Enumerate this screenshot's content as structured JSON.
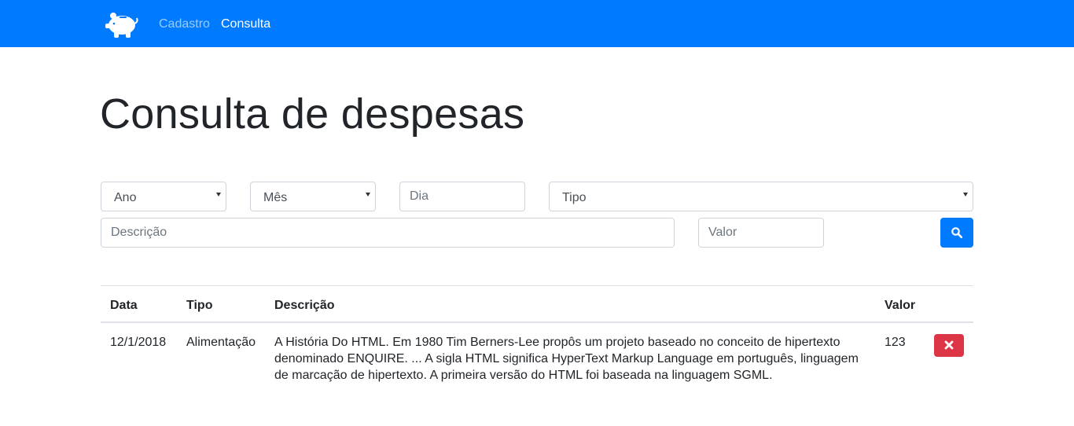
{
  "navbar": {
    "logo_icon": "piggy-bank-icon",
    "links": [
      {
        "label": "Cadastro",
        "active": false
      },
      {
        "label": "Consulta",
        "active": true
      }
    ],
    "background": "#007bff"
  },
  "page": {
    "title": "Consulta de despesas"
  },
  "filters": {
    "ano": {
      "value": "Ano",
      "type": "select"
    },
    "mes": {
      "value": "Mês",
      "type": "select"
    },
    "dia": {
      "placeholder": "Dia",
      "value": ""
    },
    "tipo": {
      "value": "Tipo",
      "type": "select"
    },
    "descricao": {
      "placeholder": "Descrição",
      "value": ""
    },
    "valor": {
      "placeholder": "Valor",
      "value": ""
    },
    "search_button_icon": "search-icon"
  },
  "table": {
    "headers": [
      "Data",
      "Tipo",
      "Descrição",
      "Valor"
    ],
    "rows": [
      {
        "data": "12/1/2018",
        "tipo": "Alimentação",
        "descricao": "A História Do HTML. Em 1980 Tim Berners-Lee propôs um projeto baseado no conceito de hipertexto denominado ENQUIRE. ... A sigla HTML significa HyperText Markup Language em português, linguagem de marcação de hipertexto. A primeira versão do HTML foi baseada na linguagem SGML.",
        "valor": "123",
        "delete_icon": "close-icon"
      }
    ]
  },
  "colors": {
    "primary": "#007bff",
    "danger": "#dc3545"
  }
}
